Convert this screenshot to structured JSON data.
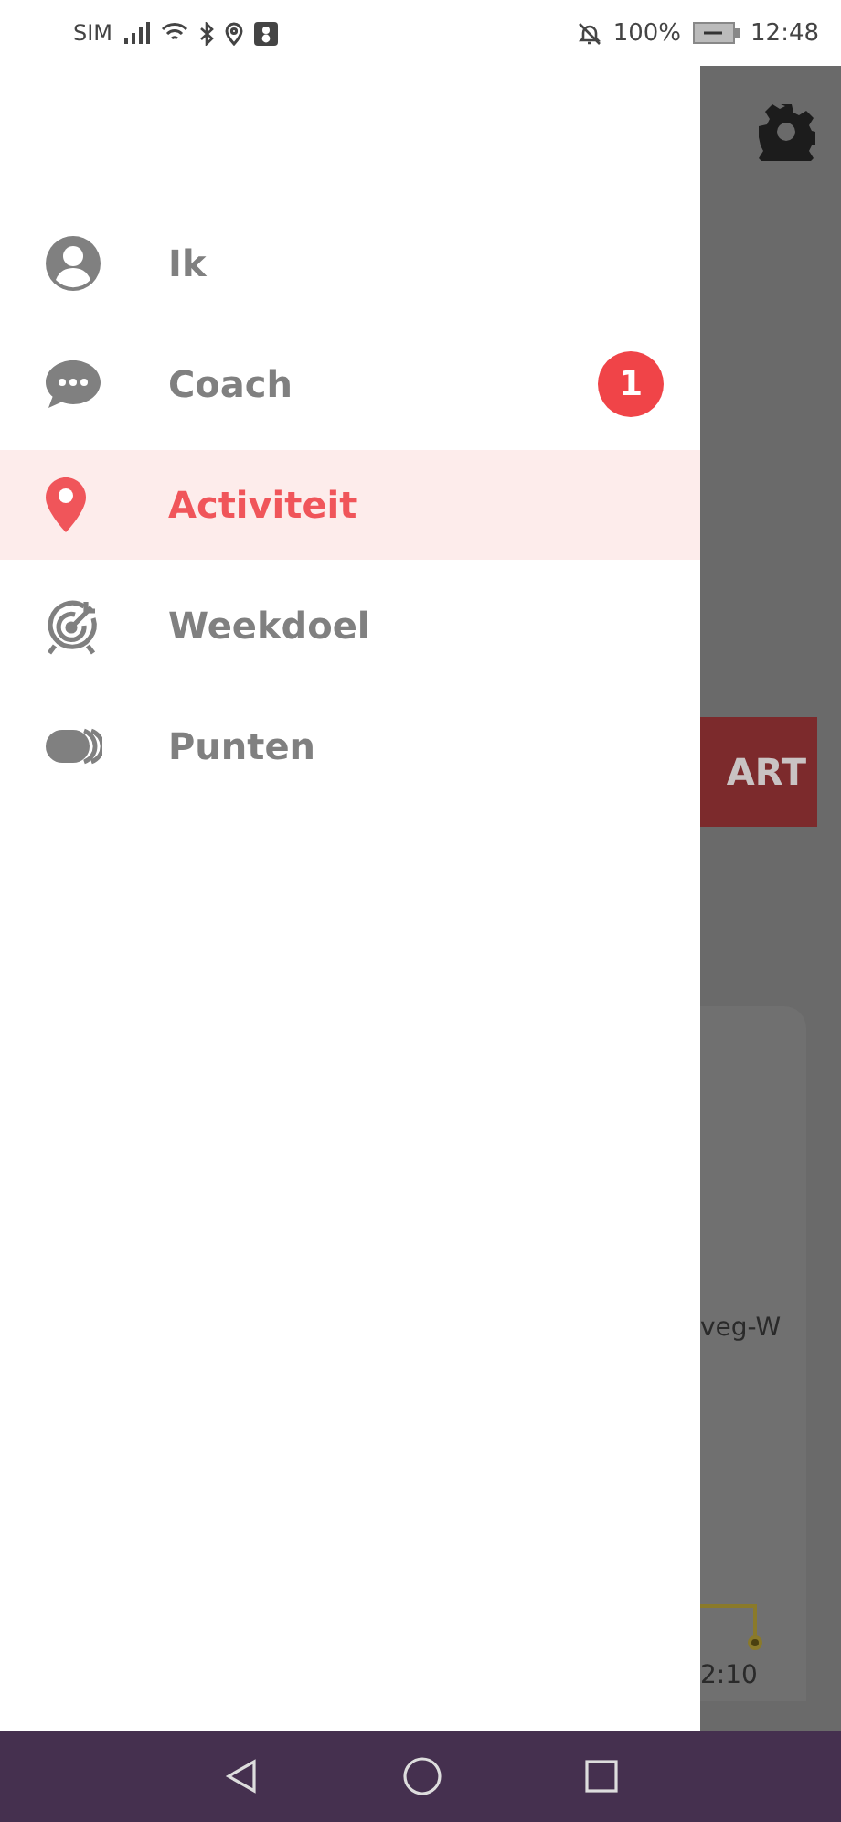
{
  "status_bar": {
    "carrier": "SIM",
    "battery": "100%",
    "time": "12:48"
  },
  "drawer": {
    "items": [
      {
        "kind": "person",
        "label": "Ik",
        "selected": false
      },
      {
        "kind": "chat",
        "label": "Coach",
        "selected": false,
        "badge": "1"
      },
      {
        "kind": "pin",
        "label": "Activiteit",
        "selected": true
      },
      {
        "kind": "target",
        "label": "Weekdoel",
        "selected": false
      },
      {
        "kind": "coins",
        "label": "Punten",
        "selected": false
      }
    ]
  },
  "background": {
    "button": "ART",
    "map_label": "veg-W",
    "time": "2:10"
  }
}
